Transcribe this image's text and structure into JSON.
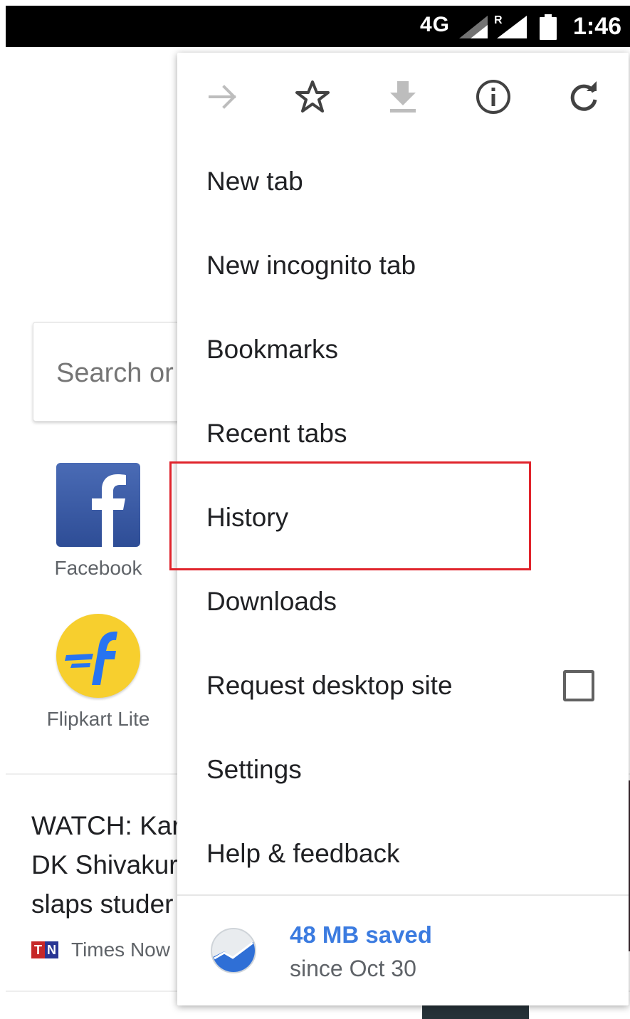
{
  "status_bar": {
    "network": "4G",
    "roaming": "R",
    "time": "1:46"
  },
  "page": {
    "search_placeholder": "Search or",
    "tiles": [
      {
        "label": "Facebook",
        "icon": "facebook-logo",
        "color": "#3b5998"
      },
      {
        "label": "Flipkart Lite",
        "icon": "flipkart-logo",
        "color": "#f7cf2e"
      }
    ],
    "article": {
      "title_lines": [
        "WATCH: Kar",
        "DK Shivakur",
        "slaps studer"
      ],
      "source_logo": [
        "T",
        "N"
      ],
      "source": "Times Now"
    }
  },
  "menu": {
    "icons": [
      {
        "name": "forward-arrow-icon",
        "enabled": false
      },
      {
        "name": "star-icon",
        "enabled": true
      },
      {
        "name": "download-icon",
        "enabled": false
      },
      {
        "name": "info-icon",
        "enabled": true
      },
      {
        "name": "reload-icon",
        "enabled": true
      }
    ],
    "items": [
      {
        "label": "New tab"
      },
      {
        "label": "New incognito tab"
      },
      {
        "label": "Bookmarks"
      },
      {
        "label": "Recent tabs"
      },
      {
        "label": "History"
      },
      {
        "label": "Downloads"
      },
      {
        "label": "Request desktop site",
        "checkbox": false
      },
      {
        "label": "Settings"
      },
      {
        "label": "Help & feedback"
      }
    ],
    "highlighted_item": "History",
    "highlight_color": "#e0242c",
    "data_saver": {
      "main": "48 MB saved",
      "sub": "since Oct 30",
      "color": "#3b7be0"
    }
  }
}
